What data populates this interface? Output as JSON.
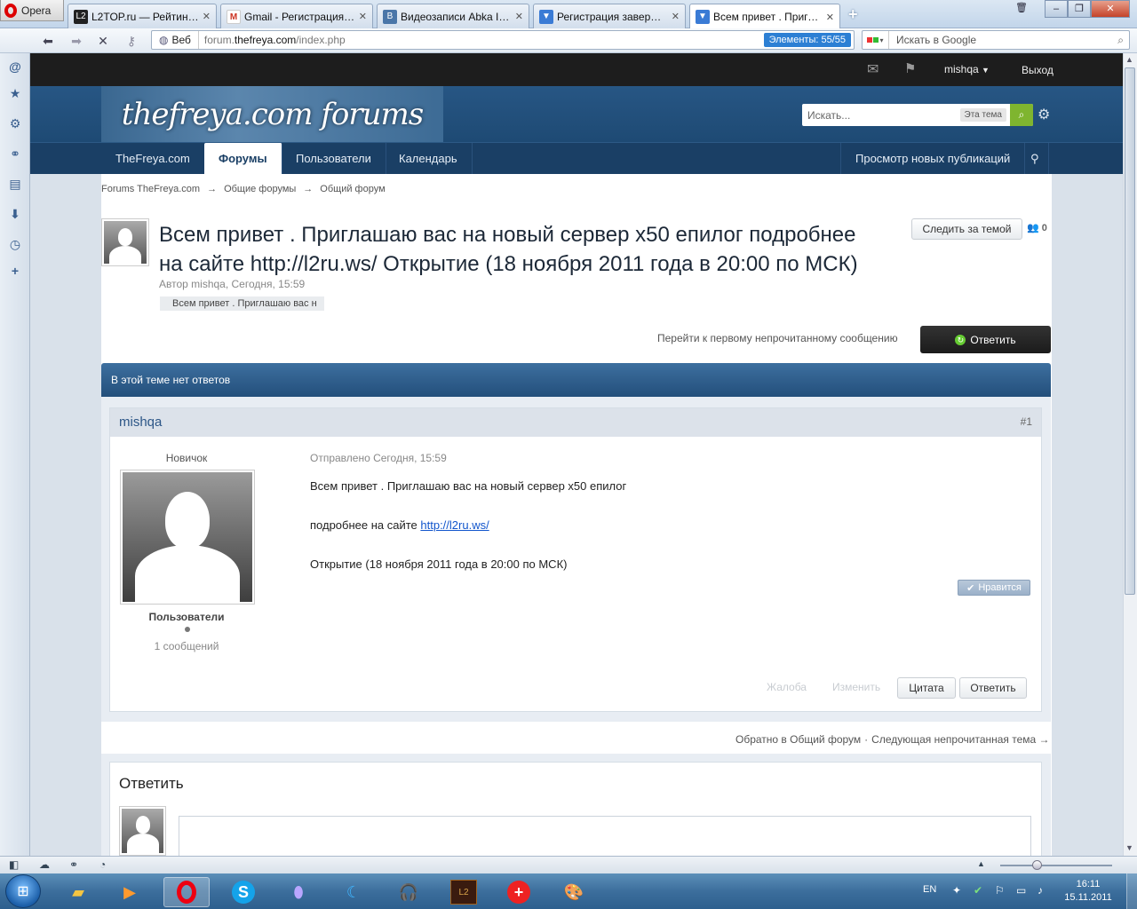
{
  "browser": {
    "menu_label": "Opera",
    "tabs": [
      {
        "title": "L2TOP.ru — Рейтинг С...",
        "icon": "l2top-icon",
        "color": "#222222"
      },
      {
        "title": "Gmail - Регистрация н...",
        "icon": "gmail-icon",
        "color": "#cc3322"
      },
      {
        "title": "Видеозаписи Abka Im......",
        "icon": "vk-icon",
        "color": "#4a76a8"
      },
      {
        "title": "Регистрация заверше...",
        "icon": "freya-icon",
        "color": "#3a7bd5"
      },
      {
        "title": "Всем привет . Пригла...",
        "icon": "freya-icon",
        "color": "#3a7bd5"
      }
    ],
    "address": {
      "web_label": "Веб",
      "url_prefix": "forum.",
      "url_domain": "thefreya.com",
      "url_path": "/index.php",
      "elements_badge": "Элементы:  55/55"
    },
    "search_placeholder": "Искать в Google"
  },
  "forum": {
    "user_menu": {
      "username": "mishqa",
      "logout": "Выход"
    },
    "logo_text": "thefreya.com forums",
    "search": {
      "placeholder": "Искать...",
      "scope": "Эта тема"
    },
    "nav": {
      "tabs": [
        "TheFreya.com",
        "Форумы",
        "Пользователи",
        "Календарь"
      ],
      "active_index": 1,
      "new_posts": "Просмотр новых публикаций"
    },
    "breadcrumb": [
      "Forums TheFreya.com",
      "Общие форумы",
      "Общий форум"
    ],
    "breadcrumb_sep": "→",
    "topic": {
      "title_line1": "Всем привет . Приглашаю вас на новый сервер x50 епилог подробнее",
      "title_line2": "на сайте http://l2ru.ws/ Открытие (18 ноября 2011 года в 20:00 по МСК)",
      "meta": "Автор mishqa, Сегодня, 15:59",
      "tag": "Всем привет . Приглашаю вас н",
      "follow_button": "Следить за темой",
      "followers_count": "0",
      "first_unread": "Перейти к первому непрочитанному сообщению",
      "reply_button": "Ответить",
      "no_replies": "В этой теме нет ответов"
    },
    "post": {
      "author": "mishqa",
      "number": "#1",
      "rank": "Новичок",
      "group": "Пользователи",
      "post_count": "1 сообщений",
      "posted": "Отправлено Сегодня, 15:59",
      "line1": "Всем привет . Приглашаю вас на новый сервер x50 епилог",
      "line2_text": "подробнее на сайте ",
      "line2_link": "http://l2ru.ws/",
      "line3": "Открытие (18 ноября 2011 года в 20:00 по МСК)",
      "like": "Нравится",
      "report": "Жалоба",
      "edit": "Изменить",
      "quote": "Цитата",
      "reply": "Ответить"
    },
    "bottom_nav": {
      "back": "Обратно в Общий форум",
      "sep": "·",
      "next": "Следующая непрочитанная тема →"
    },
    "reply_box": {
      "title": "Ответить"
    }
  },
  "taskbar": {
    "lang": "EN",
    "time": "16:11",
    "date": "15.11.2011"
  }
}
